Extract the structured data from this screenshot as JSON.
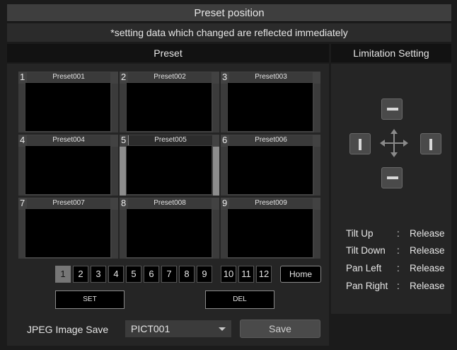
{
  "title": "Preset position",
  "subtitle": "*setting data which changed are reflected immediately",
  "headers": {
    "preset": "Preset",
    "limitation": "Limitation Setting"
  },
  "presets": [
    {
      "num": "1",
      "name": "Preset001"
    },
    {
      "num": "2",
      "name": "Preset002"
    },
    {
      "num": "3",
      "name": "Preset003"
    },
    {
      "num": "4",
      "name": "Preset004"
    },
    {
      "num": "5",
      "name": "Preset005"
    },
    {
      "num": "6",
      "name": "Preset006"
    },
    {
      "num": "7",
      "name": "Preset007"
    },
    {
      "num": "8",
      "name": "Preset008"
    },
    {
      "num": "9",
      "name": "Preset009"
    }
  ],
  "selected_preset": "5",
  "pages": [
    "1",
    "2",
    "3",
    "4",
    "5",
    "6",
    "7",
    "8",
    "9",
    "10",
    "11",
    "12"
  ],
  "active_page": "1",
  "buttons": {
    "home": "Home",
    "set": "SET",
    "del": "DEL",
    "save": "Save"
  },
  "jpeg": {
    "label": "JPEG Image Save",
    "selected": "PICT001"
  },
  "limitation": [
    {
      "label": "Tilt Up",
      "sep": ":",
      "value": "Release"
    },
    {
      "label": "Tilt Down",
      "sep": ":",
      "value": "Release"
    },
    {
      "label": "Pan Left",
      "sep": ":",
      "value": "Release"
    },
    {
      "label": "Pan Right",
      "sep": ":",
      "value": "Release"
    }
  ],
  "icons": {
    "move": "four-way-arrow-icon",
    "limit_up": "limit-up-icon",
    "limit_down": "limit-down-icon",
    "limit_left": "limit-left-icon",
    "limit_right": "limit-right-icon",
    "dropdown": "chevron-down-icon"
  }
}
